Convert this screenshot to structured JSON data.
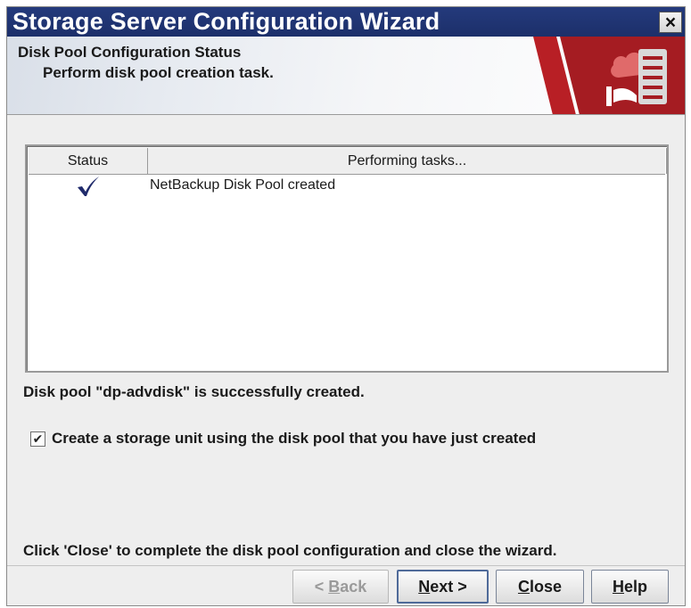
{
  "window": {
    "title": "Storage Server Configuration Wizard",
    "close_glyph": "×"
  },
  "header": {
    "title": "Disk Pool Configuration Status",
    "subtitle": "Perform disk pool creation task."
  },
  "tasks_table": {
    "columns": [
      "Status",
      "Performing tasks..."
    ],
    "rows": [
      {
        "status_icon": "checkmark-icon",
        "task": "NetBackup Disk Pool created"
      }
    ]
  },
  "success_message": "Disk pool \"dp-advdisk\" is successfully created.",
  "storage_unit_checkbox": {
    "checked": true,
    "label": "Create a storage unit using the disk pool that you have just created"
  },
  "footer_message": "Click 'Close' to complete the disk pool configuration and close the wizard.",
  "buttons": {
    "back": {
      "prefix": "< ",
      "mnemonic": "B",
      "rest": "ack",
      "enabled": false
    },
    "next": {
      "mnemonic": "N",
      "rest": "ext >",
      "enabled": true
    },
    "close": {
      "mnemonic": "C",
      "rest": "lose",
      "enabled": true
    },
    "help": {
      "mnemonic": "H",
      "rest": "elp",
      "enabled": true
    }
  },
  "colors": {
    "titlebar": "#1c2f6a",
    "brand_red": "#a51c22",
    "checkmark": "#1f2a6b"
  }
}
